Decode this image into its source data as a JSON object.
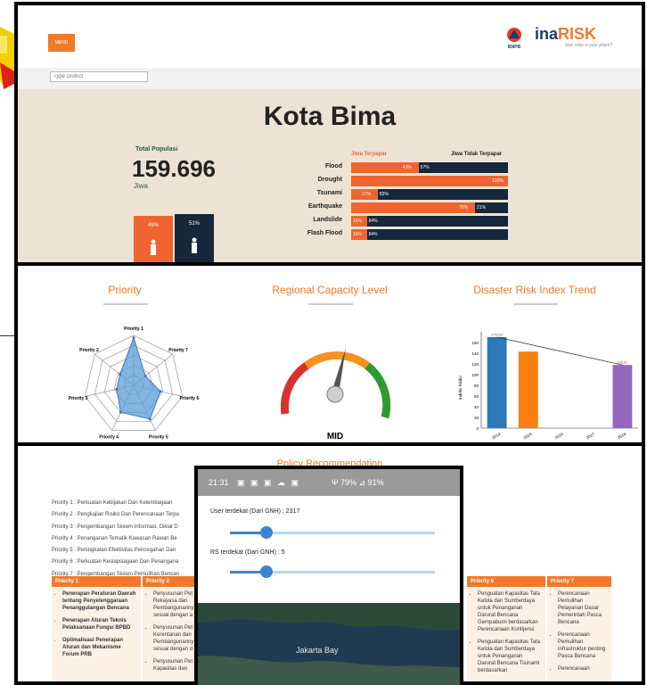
{
  "header": {
    "menu_label": "MENU",
    "brand_ina": "ina",
    "brand_risk": "RISK",
    "tagline": "how risky is your place?",
    "bnpb": "BNPB"
  },
  "search": {
    "placeholder": "Type District"
  },
  "summary": {
    "city": "Kota Bima",
    "population_label": "Total Populasi",
    "population_value": "159.696",
    "population_unit": "Jiwa",
    "gender": [
      {
        "pct": "49%",
        "color": "#f0652f"
      },
      {
        "pct": "51%",
        "color": "#16283b"
      }
    ]
  },
  "hazards": {
    "header_affected": "Jiwa Terpapar",
    "header_unaffected": "Jiwa Tidak Terpapar",
    "rows": [
      {
        "label": "Flood",
        "affected": 0.43,
        "pct1": "43%",
        "pct2": "57%"
      },
      {
        "label": "Drought",
        "affected": 1.0,
        "pct1": "100%",
        "pct2": ""
      },
      {
        "label": "Tsunami",
        "affected": 0.17,
        "pct1": "17%",
        "pct2": "83%"
      },
      {
        "label": "Earthquake",
        "affected": 0.79,
        "pct1": "79%",
        "pct2": "21%"
      },
      {
        "label": "Landslide",
        "affected": 0.1,
        "pct1": "16%",
        "pct2": "84%"
      },
      {
        "label": "Flash Flood",
        "affected": 0.1,
        "pct1": "16%",
        "pct2": "84%"
      }
    ]
  },
  "panel2": {
    "priority_title": "Priority",
    "capacity_title": "Regional Capacity Level",
    "trend_title": "Disaster Risk Index Trend",
    "radar_labels": [
      "Priority 1",
      "Priority 7",
      "Priority 6",
      "Priority 5",
      "Priority 4",
      "Priority 3",
      "Priority 2"
    ],
    "gauge_label": "MID",
    "chart_data": {
      "type": "bar",
      "categories": [
        "2014",
        "2015",
        "2016",
        "2017",
        "2018"
      ],
      "values": [
        170.05,
        143,
        null,
        null,
        118.01
      ],
      "value_labels": [
        "170.05",
        "",
        "",
        "",
        "118.01"
      ],
      "colors": [
        "#2f78b7",
        "#f97f0e",
        "#2f78b7",
        "#2f78b7",
        "#9467bd"
      ],
      "ylabel": "Indeks Risiko",
      "ylim": [
        0,
        180
      ],
      "yticks": [
        "0",
        "20",
        "40",
        "60",
        "80",
        "100",
        "120",
        "140",
        "160"
      ]
    }
  },
  "policy": {
    "title": "Policy Recommendation",
    "items": [
      "Priority 1 : Perkuatan Kebijakan Dan Kelembagaan",
      "Priority 2 : Pengkajian Risiko Dan Perencanaan Terpa",
      "Priority 3 : Pengembangan Sistem Informasi, Diklat D",
      "Priority 4 : Penanganan Tematik Kawasan Rawan Be",
      "Priority 5 : Peningkatan Efektivitas Pencegahan Dan",
      "Priority 6 : Perkuatan Kesiapsiagaan Dan Penangana",
      "Priority 7 : Pengembangan Sistem Pemulihan Bencan"
    ],
    "col1_head": "Priority 1",
    "col2_head": "Priority 2",
    "col6_head": "Priority 6",
    "col7_head": "Priority 7",
    "col1": [
      "Penerapan Peraturan Daerah tentang Penyelenggaraan Penanggulangan Bencana",
      "Penerapan Aturan Teknis Pelaksanaan Fungsi BPBD",
      "Optimalisasi Penerapan Aturan dan Mekanisme Forum PRB"
    ],
    "col2": [
      "Penyusunan Pet Rekayasa dan Pembangunanny sesuai dengan a",
      "Penyusunan Pet Kerentanan dan Pembangunanny sesuai dengan d",
      "Penyusunan Pet Kapasitas dan"
    ],
    "col6": [
      "Penguatan Kapasitas Tata Kelola dan Sumberdaya untuk Penanganan Darurat Bencana Gempabumi berdasarkan Perencanaan Kontijensi",
      "Penguatan Kapasitas Tata Kelola dan Sumberdaya untuk Penanganan Darurat Bencana Tsunami berdasarkan"
    ],
    "col7": [
      "Perencanaan Pemulihan Pelayanan Dasar Pemerintah Pasca Bencana",
      "Perencanaan Pemulihan Infrastruktur penting Pasca Bencana",
      "Perencanaan"
    ]
  },
  "overlay": {
    "time": "21:31",
    "status_right": "Ψ 79% ⊿ 91%",
    "slider1_label": "User terdekat (Dari GNH) : 2317",
    "slider1_value": 0.18,
    "slider2_label": "RS terdekat (Dari GNH) : 5",
    "slider2_value": 0.18,
    "map_label": "Jakarta Bay"
  }
}
